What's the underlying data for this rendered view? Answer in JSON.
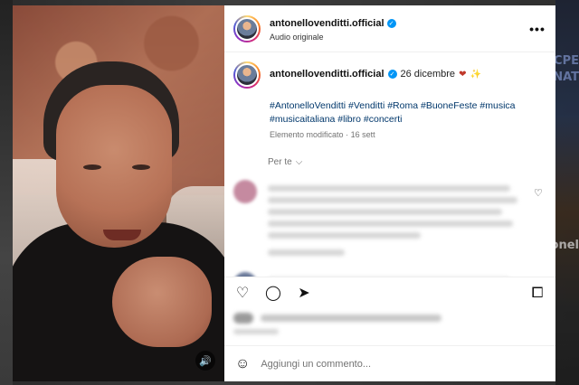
{
  "background": {
    "side_texts": [
      "ACPE",
      "NAT",
      "onel"
    ]
  },
  "post": {
    "username": "antonellovenditti.official",
    "audio_label": "Audio originale",
    "verified_glyph": "✓",
    "more_icon": "more-options-icon"
  },
  "caption": {
    "username": "antonellovenditti.official",
    "date": "26 dicembre",
    "hashtags": [
      "#AntonelloVenditti",
      "#Venditti",
      "#Roma",
      "#BuoneFeste",
      "#musica",
      "#musicaitaliana",
      "#libro",
      "#concerti"
    ],
    "edited_label": "Elemento modificato",
    "edited_time": "16 sett"
  },
  "for_you_label": "Per te",
  "comments": [
    {
      "avatar_color": "#c58aa0",
      "liked": false
    },
    {
      "avatar_color": "#6b7a9a",
      "liked": false
    }
  ],
  "actions": {
    "like_icon": "♡",
    "comment_icon": "◯",
    "share_icon": "➤",
    "save_icon": "⧠"
  },
  "composer": {
    "emoji_icon": "☺",
    "placeholder": "Aggiungi un commento..."
  },
  "colors": {
    "link": "#00376b",
    "verified": "#0095f6",
    "muted": "#737373",
    "heart": "#c0392b"
  }
}
